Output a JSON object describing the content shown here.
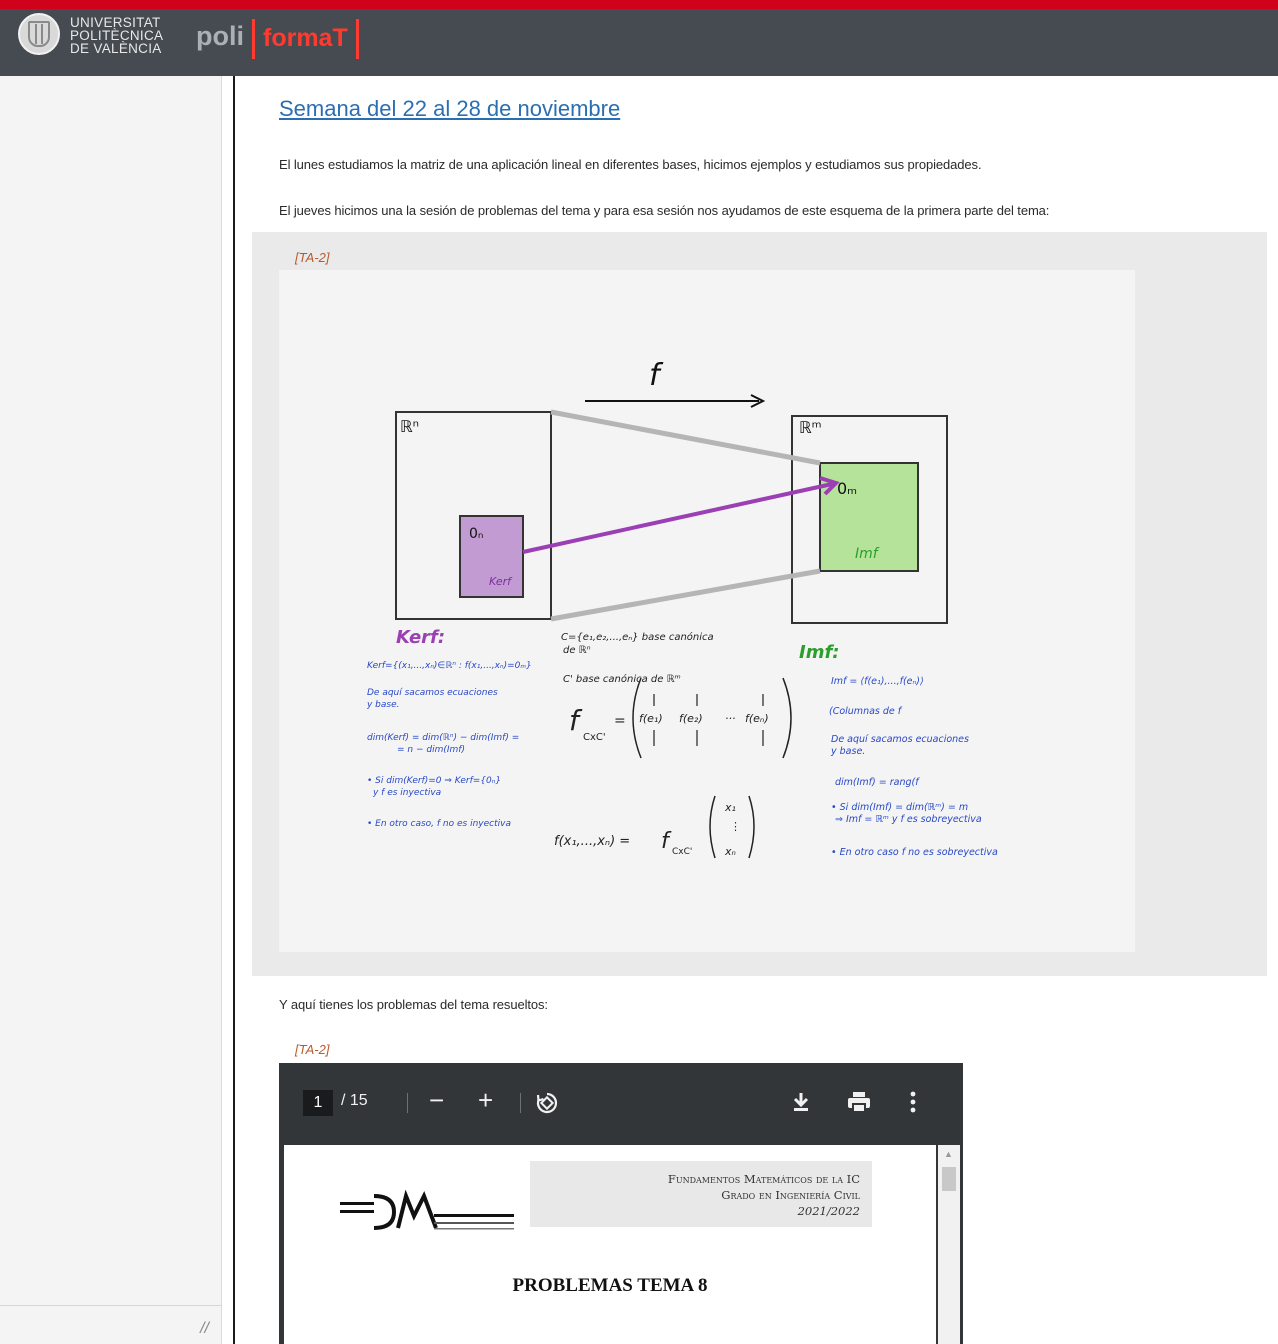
{
  "header": {
    "university_lines": [
      "UNIVERSITAT",
      "POLITÈCNICA",
      "DE VALÈNCIA"
    ],
    "brand_prefix": "poli",
    "brand_name": "formaT"
  },
  "sidebar": {
    "resize_glyph": "//"
  },
  "main": {
    "title": "Semana del 22 al 28 de noviembre",
    "para1": "El lunes estudiamos la matriz de una aplicación lineal en diferentes bases, hicimos ejemplos y estudiamos sus propiedades.",
    "para2": "El jueves hicimos una la sesión de problemas del tema y para esa sesión nos ayudamos de este esquema de la primera parte del tema:",
    "para3": "Y aquí tienes los problemas del tema resueltos:",
    "tag1": "[TA-2]",
    "tag2": "[TA-2]"
  },
  "whiteboard": {
    "arrow_label": "f",
    "domain_label": "ℝⁿ",
    "codomain_label": "ℝᵐ",
    "zero_domain": "0ₙ",
    "zero_codomain": "0ₘ",
    "kernel_label": "Kerf",
    "image_label": "Imf",
    "left_heading": "Kerf:",
    "left_notes": [
      "Kerf={(x₁,...,xₙ)∈ℝⁿ : f(x₁,...,xₙ)=0ₘ}",
      "De aquí sacamos ecuaciones",
      "y base.",
      "dim(Kerf) = dim(ℝⁿ) − dim(Imf) =",
      "= n − dim(Imf)",
      "• Si dim(Kerf)=0 ⇒ Kerf={0ₙ}",
      "y f es inyectiva",
      "• En otro caso, f no es inyectiva"
    ],
    "center_notes": [
      "C={e₁,e₂,...,eₙ} base canónica",
      "de ℝⁿ",
      "C' base canónica de ℝᵐ"
    ],
    "matrix_sub": "f",
    "matrix_index": "CxC'",
    "matrix_cols": [
      "f(e₁)",
      "f(e₂)",
      "···",
      "f(eₙ)"
    ],
    "formula_lhs": "f(x₁,...,xₙ) =",
    "vector_entries": [
      "x₁",
      "⋮",
      "xₙ"
    ],
    "right_heading": "Imf:",
    "right_notes": [
      "Imf = ⟨f(e₁),...,f(eₙ)⟩",
      "(Columnas de f",
      "De aquí sacamos ecuaciones",
      "y base.",
      "dim(Imf) = rang(f",
      "• Si dim(Imf) = dim(ℝᵐ) = m",
      "⇒ Imf = ℝᵐ y f es sobreyectiva",
      "• En otro caso f no es sobreyectiva"
    ],
    "colors": {
      "kernel": "#c39bd3",
      "image": "#b6e39a",
      "arrow": "#9b3fb5",
      "heading_left": "#9b3fb5",
      "heading_right": "#2aa02a",
      "notes": "#2848c8"
    }
  },
  "pdf_viewer": {
    "page_current": "1",
    "page_count": "/ 15",
    "zoom_out": "−",
    "zoom_in": "+",
    "course_line1": "Fundamentos Matemáticos de la IC",
    "course_line2": "Grado en Ingeniería Civil",
    "course_line3": "2021/2022",
    "doc_title": "PROBLEMAS TEMA 8"
  }
}
